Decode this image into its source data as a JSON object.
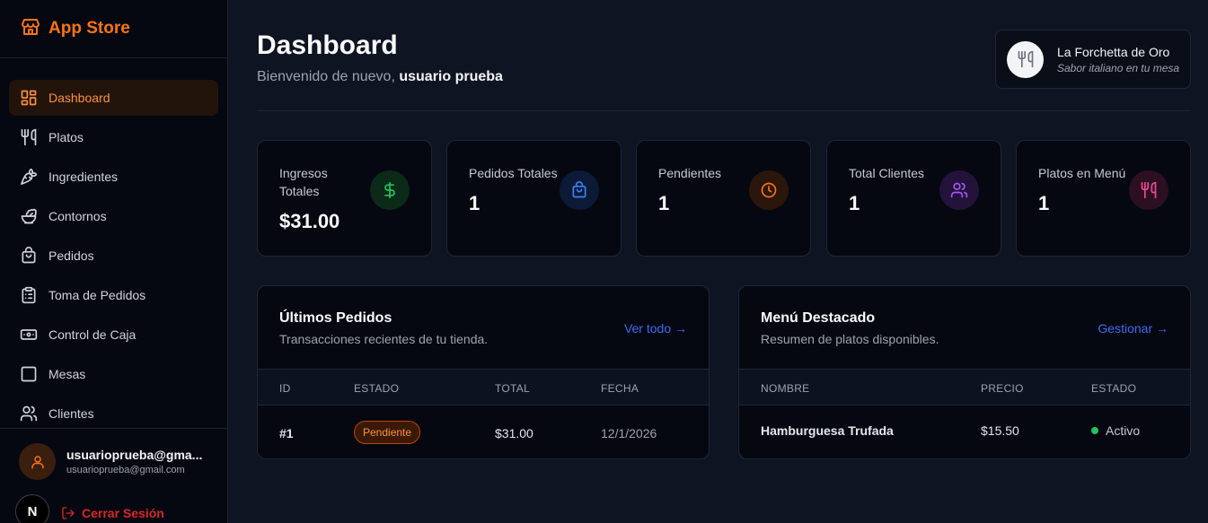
{
  "brand": {
    "name": "App Store",
    "accent": "#f97316"
  },
  "sidebar": {
    "items": [
      {
        "label": "Dashboard",
        "icon": "dashboard-grid-icon",
        "active": true
      },
      {
        "label": "Platos",
        "icon": "utensils-icon"
      },
      {
        "label": "Ingredientes",
        "icon": "carrot-icon"
      },
      {
        "label": "Contornos",
        "icon": "salad-bowl-icon"
      },
      {
        "label": "Pedidos",
        "icon": "shopping-bag-icon"
      },
      {
        "label": "Toma de Pedidos",
        "icon": "clipboard-list-icon"
      },
      {
        "label": "Control de Caja",
        "icon": "cash-register-icon"
      },
      {
        "label": "Mesas",
        "icon": "square-icon"
      },
      {
        "label": "Clientes",
        "icon": "users-icon"
      }
    ]
  },
  "user": {
    "name": "usuarioprueba@gma...",
    "email": "usuarioprueba@gmail.com",
    "framework_badge": "N",
    "logout_label": "Cerrar Sesión"
  },
  "header": {
    "title": "Dashboard",
    "welcome_prefix": "Bienvenido de nuevo,",
    "welcome_user": "usuario prueba"
  },
  "restaurant": {
    "name": "La Forchetta de Oro",
    "tagline": "Sabor italiano en tu mesa"
  },
  "stats": [
    {
      "label": "Ingresos Totales",
      "value": "$31.00",
      "icon": "dollar-icon",
      "color": "#22c55e"
    },
    {
      "label": "Pedidos Totales",
      "value": "1",
      "icon": "shopping-bag-icon",
      "color": "#3b82f6"
    },
    {
      "label": "Pendientes",
      "value": "1",
      "icon": "clock-icon",
      "color": "#f97316"
    },
    {
      "label": "Total Clientes",
      "value": "1",
      "icon": "users-icon",
      "color": "#a855f7"
    },
    {
      "label": "Platos en Menú",
      "value": "1",
      "icon": "utensils-icon",
      "color": "#ec4899"
    }
  ],
  "orders": {
    "title": "Últimos Pedidos",
    "subtitle": "Transacciones recientes de tu tienda.",
    "link": "Ver todo →",
    "columns": [
      "ID",
      "ESTADO",
      "TOTAL",
      "FECHA"
    ],
    "rows": [
      {
        "id": "#1",
        "status": "Pendiente",
        "total": "$31.00",
        "date": "12/1/2026"
      }
    ]
  },
  "menu": {
    "title": "Menú Destacado",
    "subtitle": "Resumen de platos disponibles.",
    "link": "Gestionar →",
    "columns": [
      "NOMBRE",
      "PRECIO",
      "ESTADO"
    ],
    "rows": [
      {
        "name": "Hamburguesa Trufada",
        "price": "$15.50",
        "status": "Activo"
      }
    ]
  }
}
